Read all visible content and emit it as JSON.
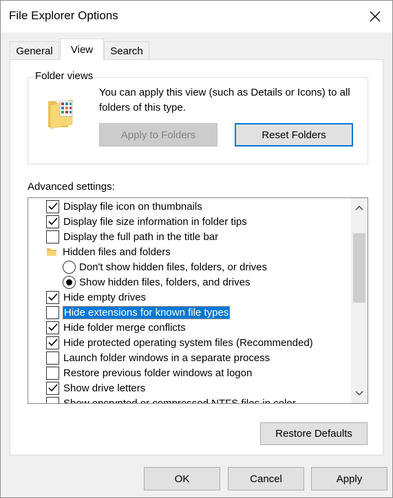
{
  "window": {
    "title": "File Explorer Options"
  },
  "tabs": [
    {
      "label": "General"
    },
    {
      "label": "View"
    },
    {
      "label": "Search"
    }
  ],
  "folder_views": {
    "title": "Folder views",
    "description": "You can apply this view (such as Details or Icons) to all folders of this type.",
    "apply_button": "Apply to Folders",
    "reset_button": "Reset Folders"
  },
  "advanced": {
    "label": "Advanced settings:",
    "items": [
      {
        "text": "Display file icon on thumbnails",
        "type": "checkbox",
        "checked": true
      },
      {
        "text": "Display file size information in folder tips",
        "type": "checkbox",
        "checked": true
      },
      {
        "text": "Display the full path in the title bar",
        "type": "checkbox",
        "checked": false
      },
      {
        "text": "Hidden files and folders",
        "type": "folder"
      },
      {
        "text": "Don't show hidden files, folders, or drives",
        "type": "radio",
        "checked": false
      },
      {
        "text": "Show hidden files, folders, and drives",
        "type": "radio",
        "checked": true
      },
      {
        "text": "Hide empty drives",
        "type": "checkbox",
        "checked": true
      },
      {
        "text": "Hide extensions for known file types",
        "type": "checkbox",
        "checked": false,
        "selected": true
      },
      {
        "text": "Hide folder merge conflicts",
        "type": "checkbox",
        "checked": true
      },
      {
        "text": "Hide protected operating system files (Recommended)",
        "type": "checkbox",
        "checked": true
      },
      {
        "text": "Launch folder windows in a separate process",
        "type": "checkbox",
        "checked": false
      },
      {
        "text": "Restore previous folder windows at logon",
        "type": "checkbox",
        "checked": false
      },
      {
        "text": "Show drive letters",
        "type": "checkbox",
        "checked": true
      },
      {
        "text": "Show encrypted or compressed NTFS files in color",
        "type": "checkbox",
        "checked": false
      }
    ]
  },
  "restore_defaults_button": "Restore Defaults",
  "footer": {
    "ok": "OK",
    "cancel": "Cancel",
    "apply": "Apply"
  },
  "colors": {
    "accent": "#0078d7",
    "selection": "#0078d7",
    "window_bg": "#f0f0f0"
  }
}
